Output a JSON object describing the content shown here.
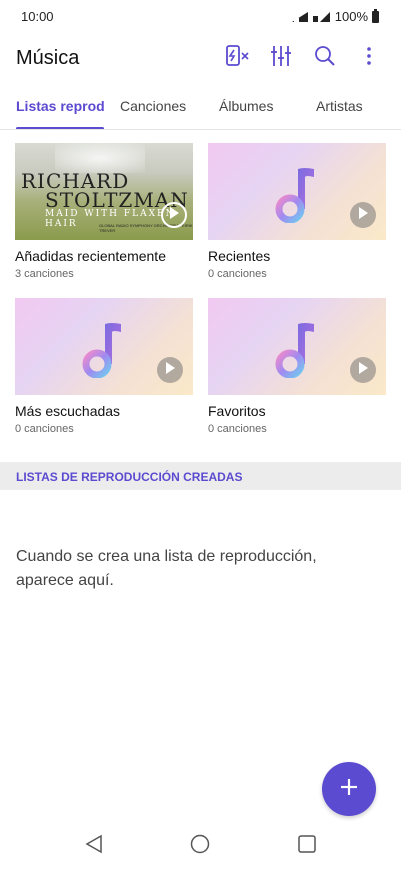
{
  "status": {
    "time": "10:00",
    "battery": "100%"
  },
  "app": {
    "title": "Música"
  },
  "icons": {
    "no_sim": "sim-off-icon",
    "equalizer": "equalizer-icon",
    "search": "search-icon",
    "more": "more-vert-icon",
    "play": "play-icon",
    "note": "music-note-icon",
    "add": "add-icon"
  },
  "tabs": [
    {
      "label": "Listas reproducción"
    },
    {
      "label": "Canciones"
    },
    {
      "label": "Álbumes"
    },
    {
      "label": "Artistas"
    }
  ],
  "playlists": [
    {
      "title": "Añadidas recientemente",
      "count": "3 canciones",
      "album": {
        "line1": "RICHARD",
        "line2": "STOLTZMAN",
        "line3": "MAID WITH FLAXEN HAIR",
        "line4": "GLOBAL RADIO SYMPHONY ORCHESTRA · EIRIK TREVER"
      }
    },
    {
      "title": "Recientes",
      "count": "0 canciones"
    },
    {
      "title": "Más escuchadas",
      "count": "0 canciones"
    },
    {
      "title": "Favoritos",
      "count": "0 canciones"
    }
  ],
  "section": {
    "label": "LISTAS DE REPRODUCCIÓN CREADAS"
  },
  "empty_message": "Cuando se crea una lista de reproducción, aparece aquí.",
  "colors": {
    "accent": "#5b4bd0"
  }
}
